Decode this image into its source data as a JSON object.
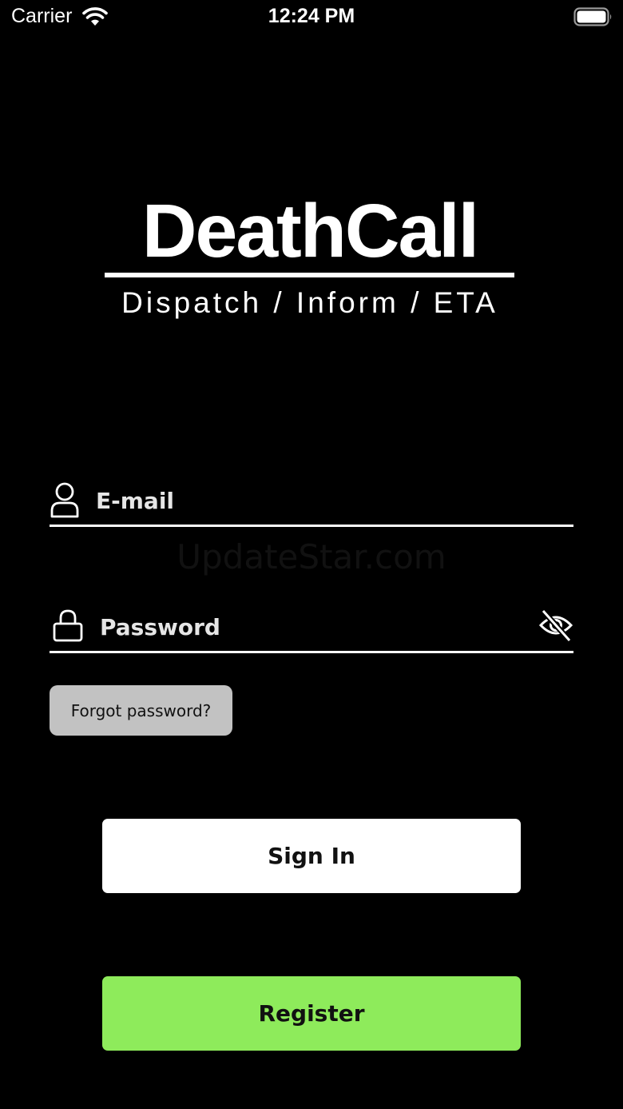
{
  "status_bar": {
    "carrier": "Carrier",
    "time": "12:24 PM",
    "wifi_icon": "wifi-icon",
    "battery_icon": "battery-icon"
  },
  "logo": {
    "title": "DeathCall",
    "tagline": "Dispatch / Inform / ETA"
  },
  "form": {
    "email": {
      "placeholder": "E-mail",
      "value": "",
      "icon": "person-icon"
    },
    "password": {
      "placeholder": "Password",
      "value": "",
      "icon": "lock-icon",
      "toggle_icon": "eye-slash-icon"
    },
    "forgot_label": "Forgot password?"
  },
  "watermark": "UpdateStar.com",
  "actions": {
    "sign_in_label": "Sign In",
    "register_label": "Register"
  },
  "colors": {
    "background": "#000000",
    "foreground": "#ffffff",
    "register_accent": "#8eeb5b",
    "forgot_bg": "#c2c2c2"
  }
}
